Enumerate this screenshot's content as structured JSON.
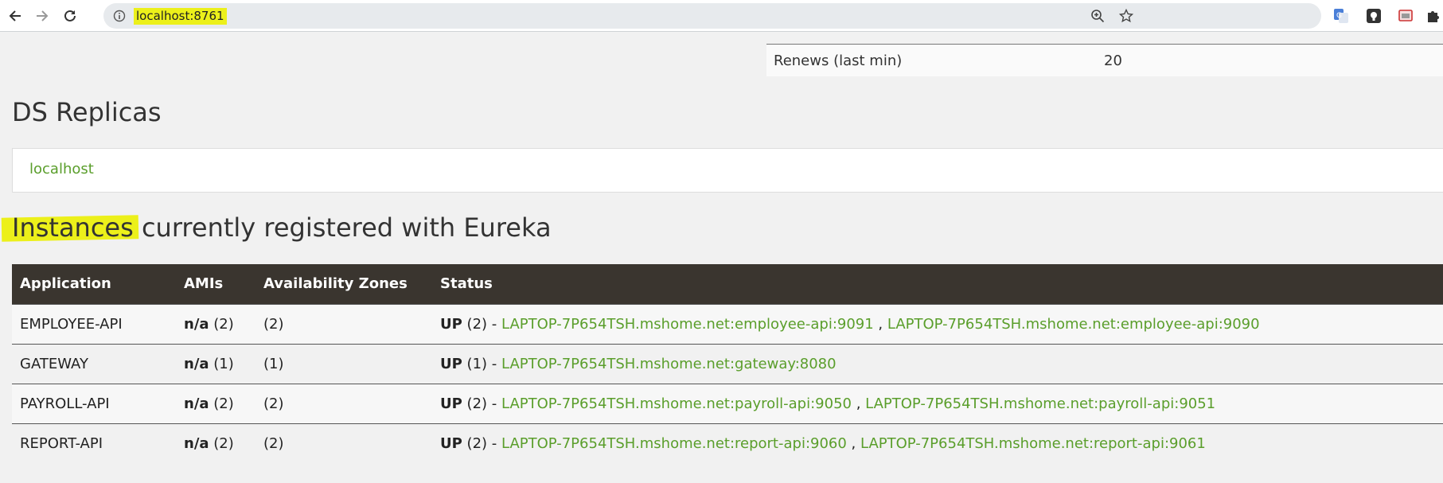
{
  "browser": {
    "url": "localhost:8761",
    "icons": [
      "back-arrow-icon",
      "forward-arrow-icon",
      "reload-icon",
      "info-icon",
      "zoom-icon",
      "bookmark-star-icon",
      "translate-extension-icon",
      "lastpass-extension-icon",
      "cast-extension-icon",
      "puzzle-extensions-icon"
    ]
  },
  "stats": {
    "label": "Renews (last min)",
    "value": "20"
  },
  "replicas": {
    "title": "DS Replicas",
    "link": "localhost"
  },
  "instances": {
    "title": "Instances currently registered with Eureka",
    "headers": [
      "Application",
      "AMIs",
      "Availability Zones",
      "Status"
    ],
    "rows": [
      {
        "app": "EMPLOYEE-API",
        "ami_value": "n/a",
        "ami_count": "(2)",
        "zones": "(2)",
        "status_label": "UP",
        "status_count": "(2)",
        "sep": " - ",
        "links": [
          "LAPTOP-7P654TSH.mshome.net:employee-api:9091",
          "LAPTOP-7P654TSH.mshome.net:employee-api:9090"
        ]
      },
      {
        "app": "GATEWAY",
        "ami_value": "n/a",
        "ami_count": "(1)",
        "zones": "(1)",
        "status_label": "UP",
        "status_count": "(1)",
        "sep": " - ",
        "links": [
          "LAPTOP-7P654TSH.mshome.net:gateway:8080"
        ]
      },
      {
        "app": "PAYROLL-API",
        "ami_value": "n/a",
        "ami_count": "(2)",
        "zones": "(2)",
        "status_label": "UP",
        "status_count": "(2)",
        "sep": " - ",
        "links": [
          "LAPTOP-7P654TSH.mshome.net:payroll-api:9050",
          "LAPTOP-7P654TSH.mshome.net:payroll-api:9051"
        ]
      },
      {
        "app": "REPORT-API",
        "ami_value": "n/a",
        "ami_count": "(2)",
        "zones": "(2)",
        "status_label": "UP",
        "status_count": "(2)",
        "sep": " - ",
        "links": [
          "LAPTOP-7P654TSH.mshome.net:report-api:9060",
          "LAPTOP-7P654TSH.mshome.net:report-api:9061"
        ]
      }
    ],
    "link_separator": " , "
  },
  "colors": {
    "accent_link": "#5a9e2b",
    "header_bg": "#3a352f",
    "highlight": "#ecf01a"
  }
}
